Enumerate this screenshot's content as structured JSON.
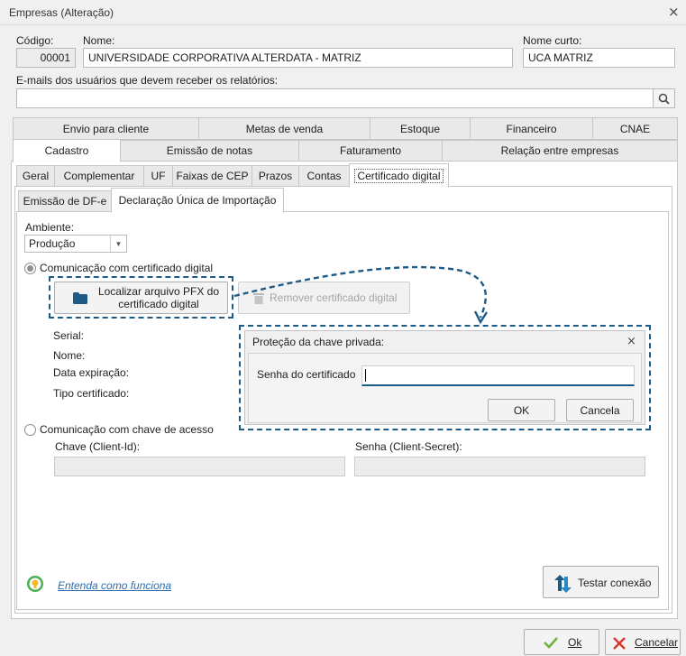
{
  "window": {
    "title": "Empresas (Alteração)"
  },
  "header": {
    "codigo_label": "Código:",
    "codigo_value": "00001",
    "nome_label": "Nome:",
    "nome_value": "UNIVERSIDADE CORPORATIVA ALTERDATA - MATRIZ",
    "nome_curto_label": "Nome curto:",
    "nome_curto_value": "UCA MATRIZ",
    "emails_label": "E-mails dos usuários que devem receber os relatórios:",
    "emails_value": ""
  },
  "tabs_row1": [
    "Envio para cliente",
    "Metas de venda",
    "Estoque",
    "Financeiro",
    "CNAE"
  ],
  "tabs_row2": [
    "Cadastro",
    "Emissão de notas",
    "Faturamento",
    "Relação entre empresas"
  ],
  "subtabs": [
    "Geral",
    "Complementar",
    "UF",
    "Faixas de CEP",
    "Prazos",
    "Contas",
    "Certificado digital"
  ],
  "subsubtabs": [
    "Emissão de DF-e",
    "Declaração Única de Importação"
  ],
  "ambiente": {
    "label": "Ambiente:",
    "value": "Produção"
  },
  "cert": {
    "radio_label": "Comunicação com certificado digital",
    "locate_button": "Localizar arquivo PFX do certificado digital",
    "locate_line1": "Localizar arquivo PFX do",
    "locate_line2": "certificado digital",
    "remove_button": "Remover certificado digital",
    "serial_label": "Serial:",
    "nome_label": "Nome:",
    "expiracao_label": "Data expiração:",
    "tipo_label": "Tipo certificado:"
  },
  "dialog": {
    "title": "Proteção da chave privada:",
    "password_label": "Senha do certificado",
    "password_value": "",
    "ok_label": "OK",
    "cancel_label": "Cancela"
  },
  "chave": {
    "radio_label": "Comunicação com chave de acesso",
    "client_id_label": "Chave (Client-Id):",
    "client_id_value": "",
    "client_secret_label": "Senha (Client-Secret):",
    "client_secret_value": ""
  },
  "help_link": "Entenda como funciona",
  "test_button": "Testar conexão",
  "footer": {
    "ok_label": "Ok",
    "cancel_label": "Cancelar"
  },
  "colors": {
    "accent": "#1e5a86",
    "link": "#2b6cb0",
    "ok_check": "#6fb43f",
    "cancel_x": "#d9342b"
  }
}
